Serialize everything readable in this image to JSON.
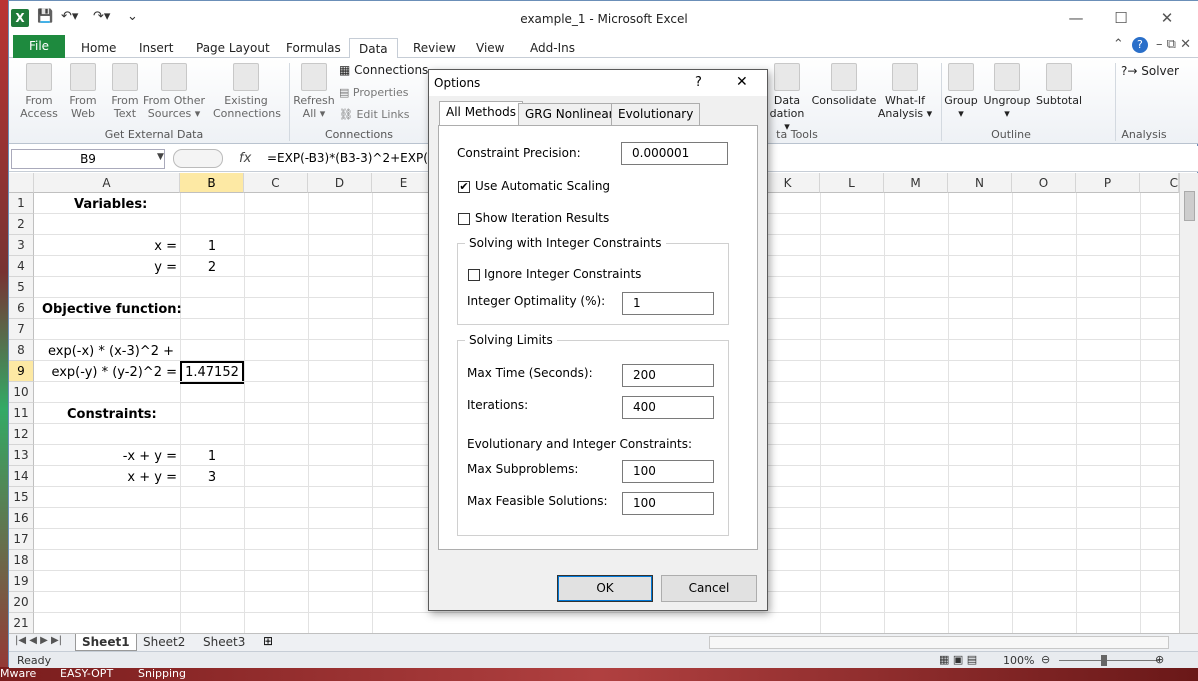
{
  "window": {
    "title": "example_1  -  Microsoft Excel",
    "app_icon": "X"
  },
  "desktop": {
    "items": [
      "Mware",
      "EASY-OPT",
      "Snipping"
    ]
  },
  "ribbon_tabs": [
    "File",
    "Home",
    "Insert",
    "Page Layout",
    "Formulas",
    "Data",
    "Review",
    "View",
    "Add-Ins"
  ],
  "ribbon": {
    "get_external": {
      "group": "Get External Data",
      "buttons": [
        [
          "From",
          "Access"
        ],
        [
          "From",
          "Web"
        ],
        [
          "From",
          "Text"
        ],
        [
          "From Other",
          "Sources ▾"
        ],
        [
          "Existing",
          "Connections"
        ]
      ]
    },
    "connections": {
      "group": "Connections",
      "refresh": [
        "Refresh",
        "All ▾"
      ],
      "items": [
        "Connections",
        "Properties",
        "Edit Links"
      ]
    },
    "data_tools": {
      "group": "ta Tools",
      "validation": [
        "Data",
        "dation ▾"
      ],
      "consolidate": "Consolidate",
      "whatif": [
        "What-If",
        "Analysis ▾"
      ]
    },
    "outline": {
      "group": "Outline",
      "buttons": [
        "Group",
        "Ungroup",
        "Subtotal"
      ]
    },
    "analysis": {
      "group": "Analysis",
      "solver": "Solver"
    }
  },
  "formula_bar": {
    "name_box": "B9",
    "fx": "fx",
    "formula": "=EXP(-B3)*(B3-3)^2+EXP("
  },
  "sheet": {
    "columns": [
      "A",
      "B",
      "C",
      "D",
      "E",
      "M",
      "N",
      "O",
      "P",
      "K",
      "L",
      "M",
      "N",
      "O",
      "P",
      "C"
    ],
    "rows": [
      "1",
      "2",
      "3",
      "4",
      "5",
      "6",
      "7",
      "8",
      "9",
      "10",
      "11",
      "12",
      "13",
      "14",
      "15",
      "16",
      "17",
      "18",
      "19",
      "20",
      "21"
    ],
    "cells": {
      "a1": "Variables:",
      "a3": "x =",
      "b3": "1",
      "a4": "y =",
      "b4": "2",
      "a6": "Objective function:",
      "a8": "exp(-x) * (x-3)^2 +",
      "a9": "exp(-y) * (y-2)^2 =",
      "b9": "1.47152",
      "a11": "Constraints:",
      "a13": "-x + y =",
      "b13": "1",
      "a14": "x + y =",
      "b14": "3"
    },
    "tabs": [
      "Sheet1",
      "Sheet2",
      "Sheet3"
    ]
  },
  "status": {
    "ready": "Ready",
    "zoom": "100%"
  },
  "dialog": {
    "title": "Options",
    "help": "?",
    "close": "✕",
    "tabs": [
      "All Methods",
      "GRG Nonlinear",
      "Evolutionary"
    ],
    "constraint_precision": {
      "label": "Constraint Precision:",
      "value": "0.000001"
    },
    "use_auto_scaling": {
      "label": "Use Automatic Scaling",
      "checked": true
    },
    "show_iter": {
      "label": "Show Iteration Results",
      "checked": false
    },
    "int_group": "Solving with Integer Constraints",
    "ignore_int": {
      "label": "Ignore Integer Constraints",
      "checked": false
    },
    "int_opt": {
      "label": "Integer Optimality (%):",
      "value": "1"
    },
    "limits_group": "Solving Limits",
    "max_time": {
      "label": "Max Time (Seconds):",
      "value": "200"
    },
    "iterations": {
      "label": "Iterations:",
      "value": "400"
    },
    "evo_heading": "Evolutionary and Integer Constraints:",
    "max_sub": {
      "label": "Max Subproblems:",
      "value": "100"
    },
    "max_feas": {
      "label": "Max Feasible Solutions:",
      "value": "100"
    },
    "ok": "OK",
    "cancel": "Cancel"
  }
}
